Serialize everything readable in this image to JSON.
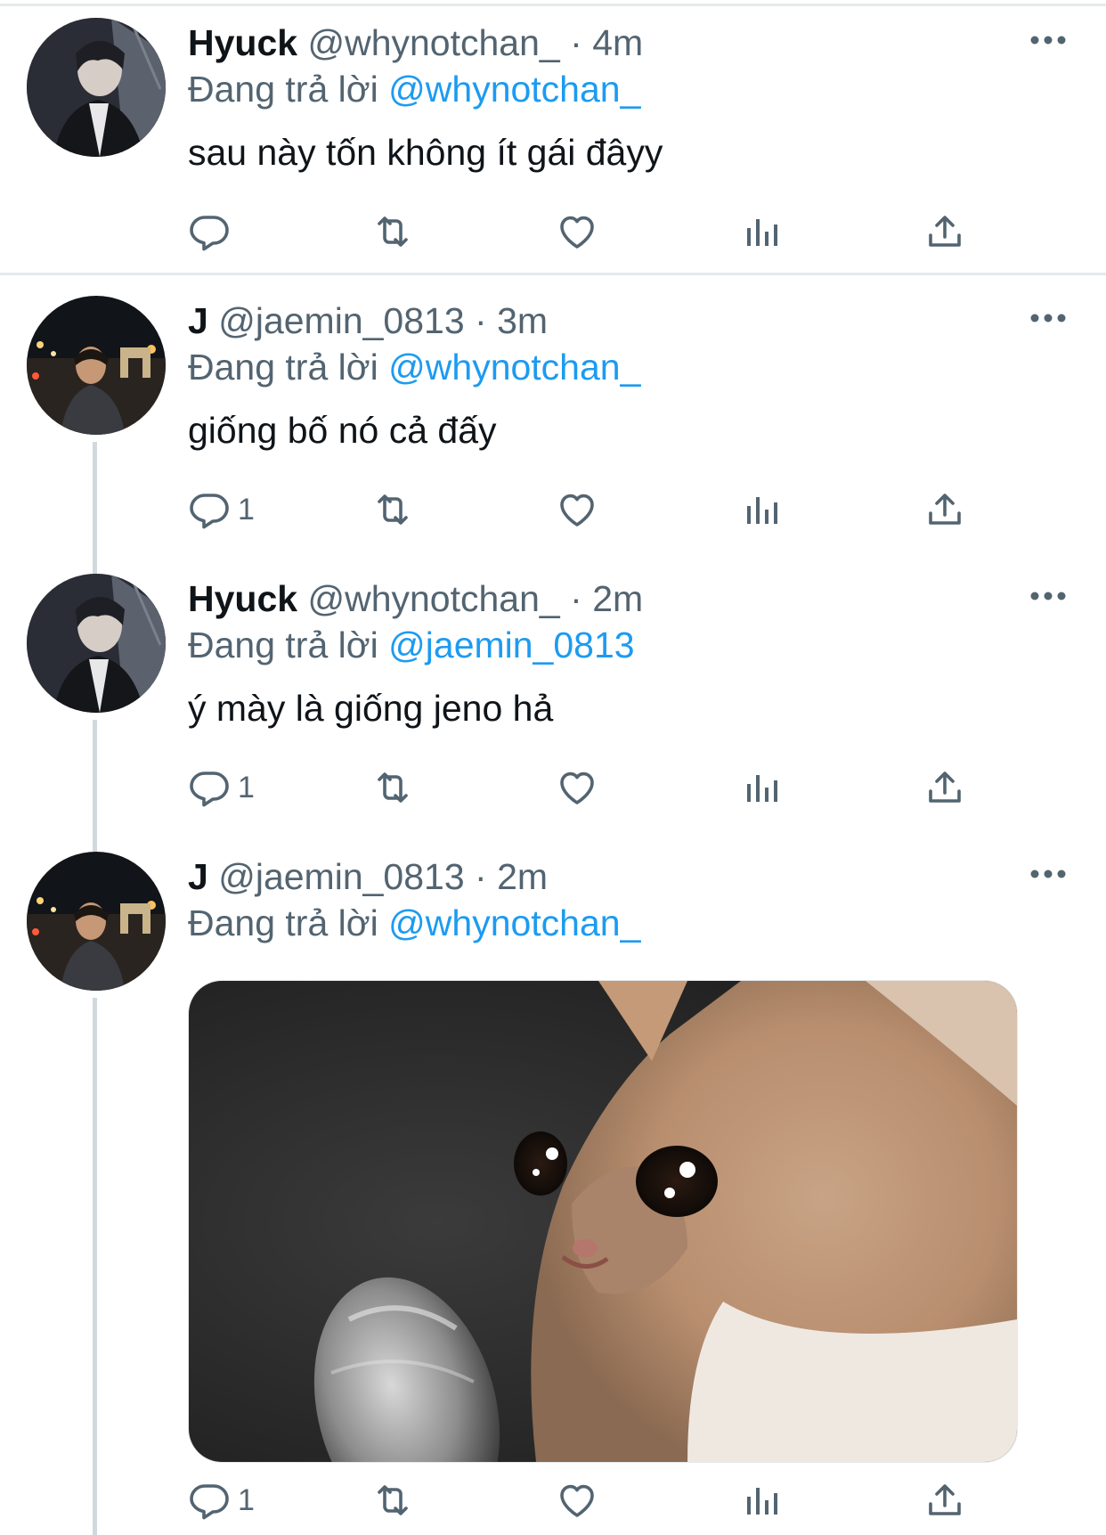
{
  "tweets": [
    {
      "name": "Hyuck",
      "handle": "@whynotchan_",
      "separator": "·",
      "time": "4m",
      "reply_prefix": "Đang trả lời",
      "reply_to": "@whynotchan_",
      "text": "sau này tốn không ít gái đâyy",
      "reply_count": "",
      "avatar": "hyuck-avatar"
    },
    {
      "name": "J",
      "handle": "@jaemin_0813",
      "separator": "·",
      "time": "3m",
      "reply_prefix": "Đang trả lời",
      "reply_to": "@whynotchan_",
      "text": "giống bố nó cả đấy",
      "reply_count": "1",
      "avatar": "j-avatar"
    },
    {
      "name": "Hyuck",
      "handle": "@whynotchan_",
      "separator": "·",
      "time": "2m",
      "reply_prefix": "Đang trả lời",
      "reply_to": "@jaemin_0813",
      "text": "ý mày là giống jeno hả",
      "reply_count": "1",
      "avatar": "hyuck-avatar"
    },
    {
      "name": "J",
      "handle": "@jaemin_0813",
      "separator": "·",
      "time": "2m",
      "reply_prefix": "Đang trả lời",
      "reply_to": "@whynotchan_",
      "text": "",
      "reply_count": "1",
      "avatar": "j-avatar",
      "media": "crying-cat-with-microphone-image"
    }
  ],
  "icons": {
    "reply": "reply-bubble-icon",
    "retweet": "retweet-icon",
    "like": "heart-icon",
    "views": "analytics-bars-icon",
    "share": "share-upload-icon",
    "more": "more-dots-icon"
  },
  "colors": {
    "link": "#1d9bf0",
    "secondary_text": "#536471",
    "primary_text": "#0f1419",
    "divider": "#e6e9ec",
    "thread_line": "#cfd9de"
  }
}
